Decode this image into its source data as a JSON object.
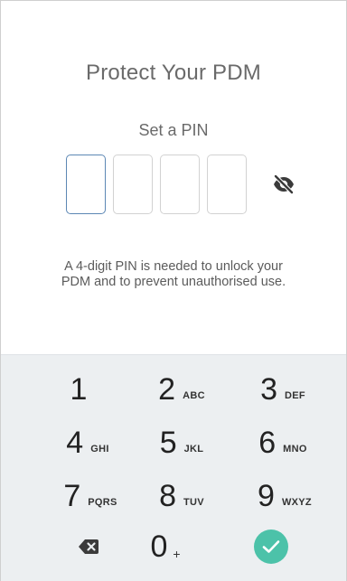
{
  "screen": {
    "title": "Protect Your PDM",
    "subtitle": "Set a PIN",
    "helper_line1": "A 4-digit PIN is needed to unlock your",
    "helper_line2": "PDM and to prevent unauthorised use."
  },
  "pin": {
    "length": 4,
    "values": [
      "",
      "",
      "",
      ""
    ],
    "active_index": 0,
    "visibility_icon": "eye-off-icon"
  },
  "keypad": {
    "keys": [
      {
        "digit": "1",
        "letters": ""
      },
      {
        "digit": "2",
        "letters": "ABC"
      },
      {
        "digit": "3",
        "letters": "DEF"
      },
      {
        "digit": "4",
        "letters": "GHI"
      },
      {
        "digit": "5",
        "letters": "JKL"
      },
      {
        "digit": "6",
        "letters": "MNO"
      },
      {
        "digit": "7",
        "letters": "PQRS"
      },
      {
        "digit": "8",
        "letters": "TUV"
      },
      {
        "digit": "9",
        "letters": "WXYZ"
      }
    ],
    "zero": {
      "digit": "0",
      "symbol": "+"
    },
    "backspace_icon": "backspace-icon",
    "done_icon": "check-icon"
  },
  "colors": {
    "keypad_bg": "#eceff1",
    "active_border": "#5c87b4",
    "done_button": "#4cc2a9",
    "text_gray": "#6a6a6a"
  }
}
